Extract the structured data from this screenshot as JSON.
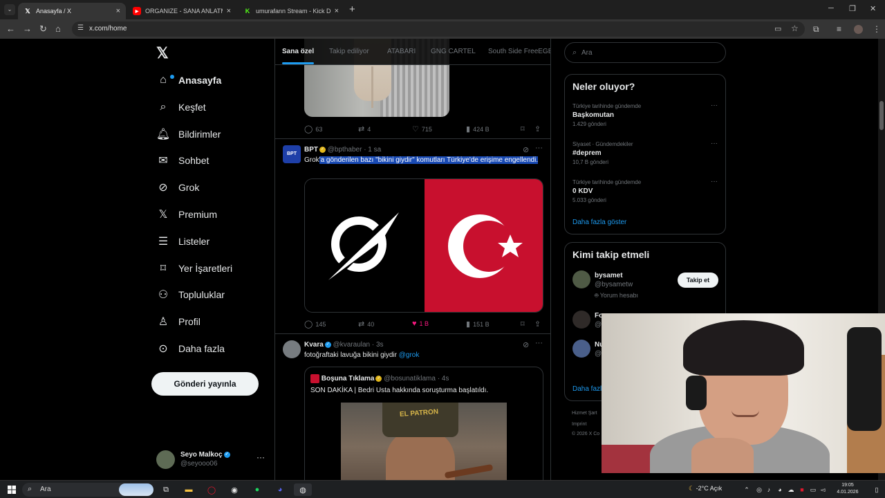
{
  "browser": {
    "tabs": [
      {
        "title": "Anasayfa / X",
        "favicon": "x-logo",
        "active": true
      },
      {
        "title": "ORGANIZE - SANA ANLATMAK",
        "favicon": "youtube-logo",
        "active": false
      },
      {
        "title": "umurafann Stream - Kick Dashb",
        "favicon": "kick-logo",
        "active": false
      }
    ],
    "url": "x.com/home"
  },
  "sidebar": {
    "items": [
      {
        "label": "Anasayfa",
        "icon": "home-icon"
      },
      {
        "label": "Keşfet",
        "icon": "search-icon"
      },
      {
        "label": "Bildirimler",
        "icon": "bell-icon"
      },
      {
        "label": "Sohbet",
        "icon": "mail-icon"
      },
      {
        "label": "Grok",
        "icon": "grok-icon"
      },
      {
        "label": "Premium",
        "icon": "x-premium-icon"
      },
      {
        "label": "Listeler",
        "icon": "list-icon"
      },
      {
        "label": "Yer İşaretleri",
        "icon": "bookmark-icon"
      },
      {
        "label": "Topluluklar",
        "icon": "communities-icon"
      },
      {
        "label": "Profil",
        "icon": "profile-icon"
      },
      {
        "label": "Daha fazla",
        "icon": "more-circle-icon"
      }
    ],
    "post_button": "Gönderi yayınla",
    "user": {
      "name": "Seyo Malkoç",
      "handle": "@seyooo06"
    }
  },
  "feed": {
    "tabs": [
      "Sana özel",
      "Takip ediliyor",
      "ATABARI",
      "GNG CARTEL",
      "South Side FreeEGE"
    ],
    "posts": [
      {
        "actions": {
          "replies": "63",
          "reposts": "4",
          "likes": "715",
          "views": "424 B"
        }
      },
      {
        "author": "BPT",
        "handle": "@bpthaber",
        "time": "· 1 sa",
        "avatar_text": "BPT",
        "text_plain": "Grok",
        "text_highlight": "'a gönderilen bazı \"bikini giydir\" komutları Türkiye'de erişime engellendi.",
        "actions": {
          "replies": "145",
          "reposts": "40",
          "likes": "1 B",
          "views": "151 B"
        }
      },
      {
        "author": "Kvara",
        "handle": "@kvaraulan",
        "time": "· 3s",
        "text": "fotoğraftaki lavuğa bikini giydir",
        "mention": "@grok",
        "quote": {
          "author": "Boşuna Tıklama",
          "handle": "@bosunatiklama",
          "time": "· 4s",
          "text": "SON DAKİKA | Bedri Usta hakkında soruşturma başlatıldı.",
          "image_text": "EL PATRON"
        }
      }
    ]
  },
  "right": {
    "search_placeholder": "Ara",
    "trends_title": "Neler oluyor?",
    "trends": [
      {
        "context": "Türkiye tarihinde gündemde",
        "name": "Başkomutan",
        "count": "1.429 gönderi"
      },
      {
        "context": "Siyaset · Gündemdekiler",
        "name": "#deprem",
        "count": "10,7 B gönderi"
      },
      {
        "context": "Türkiye tarihinde gündemde",
        "name": "0 KDV",
        "count": "5.033 gönderi"
      }
    ],
    "show_more": "Daha fazla göster",
    "who_title": "Kimi takip etmeli",
    "who": [
      {
        "name": "bysamet",
        "handle": "@bysametw",
        "label": "Yorum hesabı",
        "button": "Takip et"
      },
      {
        "name": "Fo",
        "handle": "@",
        "label": ""
      },
      {
        "name": "Nu",
        "handle": "@",
        "label": ""
      }
    ],
    "show_more_short": "Daha fazl",
    "footer": [
      "Hizmet Şart",
      "Imprint",
      "© 2026 X Co"
    ]
  },
  "taskbar": {
    "search": "Ara",
    "weather": "-2°C  Açık",
    "time": "19:05",
    "date": "4.01.2026"
  }
}
